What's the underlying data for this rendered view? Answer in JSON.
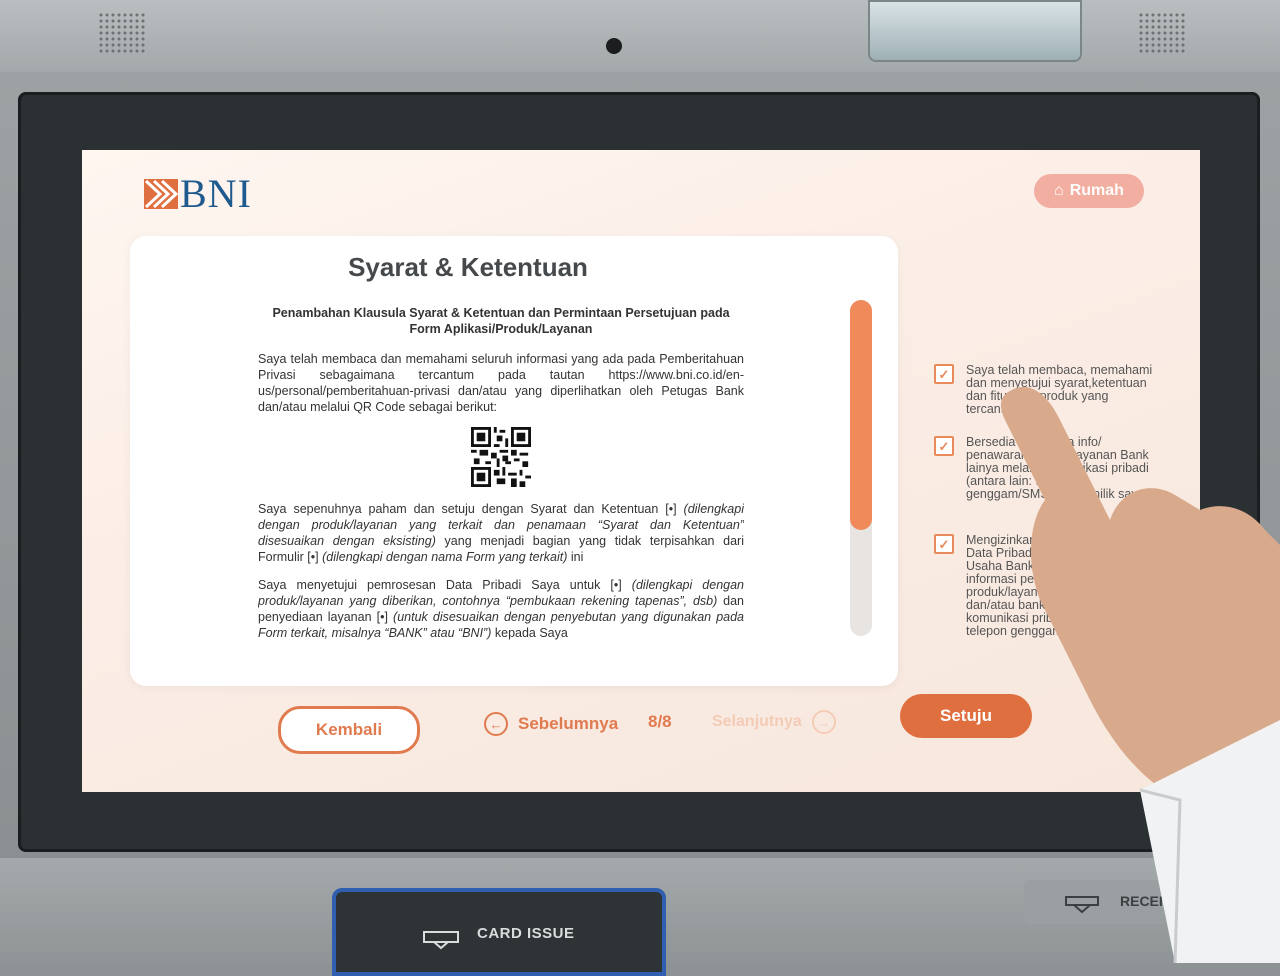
{
  "header": {
    "logo_text": "BNI",
    "home_label": "Rumah"
  },
  "document": {
    "title": "Syarat & Ketentuan",
    "heading": "Penambahan Klausula Syarat & Ketentuan dan Permintaan Persetujuan pada Form Aplikasi/Produk/Layanan",
    "paragraph1": "Saya telah membaca dan memahami seluruh informasi yang ada pada Pemberitahuan Privasi sebagaimana tercantum pada tautan https://www.bni.co.id/en-us/personal/pemberitahuan-privasi dan/atau yang diperlihatkan oleh Petugas Bank dan/atau melalui QR Code sebagai berikut:",
    "paragraph2_a": "Saya sepenuhnya paham dan setuju dengan Syarat dan Ketentuan [•] ",
    "paragraph2_b": "(dilengkapi dengan produk/layanan yang terkait dan penamaan “Syarat dan Ketentuan” disesuaikan dengan eksisting)",
    "paragraph2_c": " yang menjadi bagian yang tidak terpisahkan dari Formulir [•] ",
    "paragraph2_d": "(dilengkapi dengan nama Form yang terkait)",
    "paragraph2_e": " ini",
    "paragraph3_a": "Saya menyetujui pemrosesan Data Pribadi Saya untuk [•] ",
    "paragraph3_b": "(dilengkapi dengan produk/layanan yang diberikan, contohnya “pembukaan rekening tapenas”, dsb)",
    "paragraph3_c": " dan penyediaan layanan [•] ",
    "paragraph3_d": "(untuk disesuaikan dengan penyebutan yang digunakan pada Form terkait, misalnya “BANK” atau “BNI”)",
    "paragraph3_e": " kepada Saya"
  },
  "consents": [
    {
      "text": "Saya telah membaca, memahami dan menyetujui syarat,ketentuan dan fitur-fitur produk yang tercantum",
      "checked": true
    },
    {
      "text": "Bersedia menerima info/ penawaran produk/layanan Bank lainya melalui komunikasi pribadi (antara lain: telepon genggam/SMS/email) milik saya.",
      "checked": true
    },
    {
      "text": "Mengizinkan Bank menggunakan Data Pribadi Saya kepada Mitra Usaha Bank untuk menerima informasi penawaran produk/layanan mitra usaha dan/atau bank melalui sarana komunikasi pribadi (antara lain: telepon genggam/ SMS/email)",
      "checked": true
    }
  ],
  "footer": {
    "back_label": "Kembali",
    "prev_label": "Sebelumnya",
    "page_indicator": "8/8",
    "next_label": "Selanjutnya",
    "agree_label": "Setuju"
  },
  "hardware": {
    "card_slot_label": "CARD ISSUE",
    "receipt_label": "RECEIPT"
  },
  "scroll": {
    "position_fraction": 0.68
  },
  "colors": {
    "accent": "#e06f3f",
    "brand_blue": "#1e5a8e"
  }
}
